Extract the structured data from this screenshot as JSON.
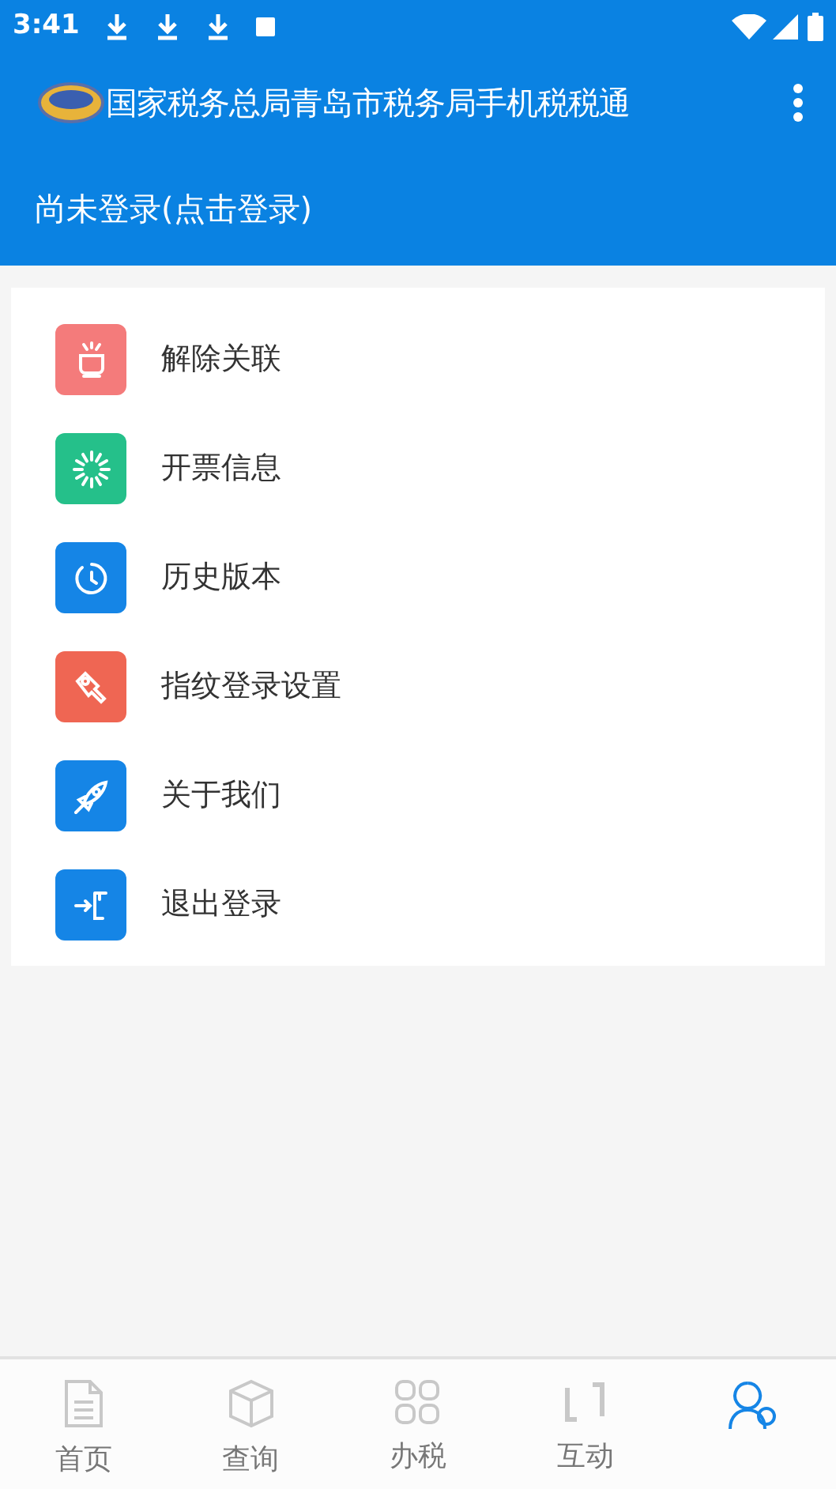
{
  "status_bar": {
    "time": "3:41"
  },
  "toolbar": {
    "title": "国家税务总局青岛市税务局手机税税通"
  },
  "login_prompt": "尚未登录(点击登录)",
  "menu_items": [
    {
      "label": "解除关联",
      "kind": "unlink",
      "color": "#f47b7b"
    },
    {
      "label": "开票信息",
      "kind": "invoice",
      "color": "#25c08a"
    },
    {
      "label": "历史版本",
      "kind": "history",
      "color": "#1585e6"
    },
    {
      "label": "指纹登录设置",
      "kind": "key",
      "color": "#ef6653"
    },
    {
      "label": "关于我们",
      "kind": "about",
      "color": "#1585e6"
    },
    {
      "label": "退出登录",
      "kind": "logout",
      "color": "#1585e6"
    }
  ],
  "bottom_nav": [
    {
      "label": "首页",
      "kind": "home",
      "selected": false
    },
    {
      "label": "查询",
      "kind": "query",
      "selected": false
    },
    {
      "label": "办税",
      "kind": "tax",
      "selected": false
    },
    {
      "label": "互动",
      "kind": "interact",
      "selected": false
    },
    {
      "kind": "me",
      "selected": true
    }
  ]
}
